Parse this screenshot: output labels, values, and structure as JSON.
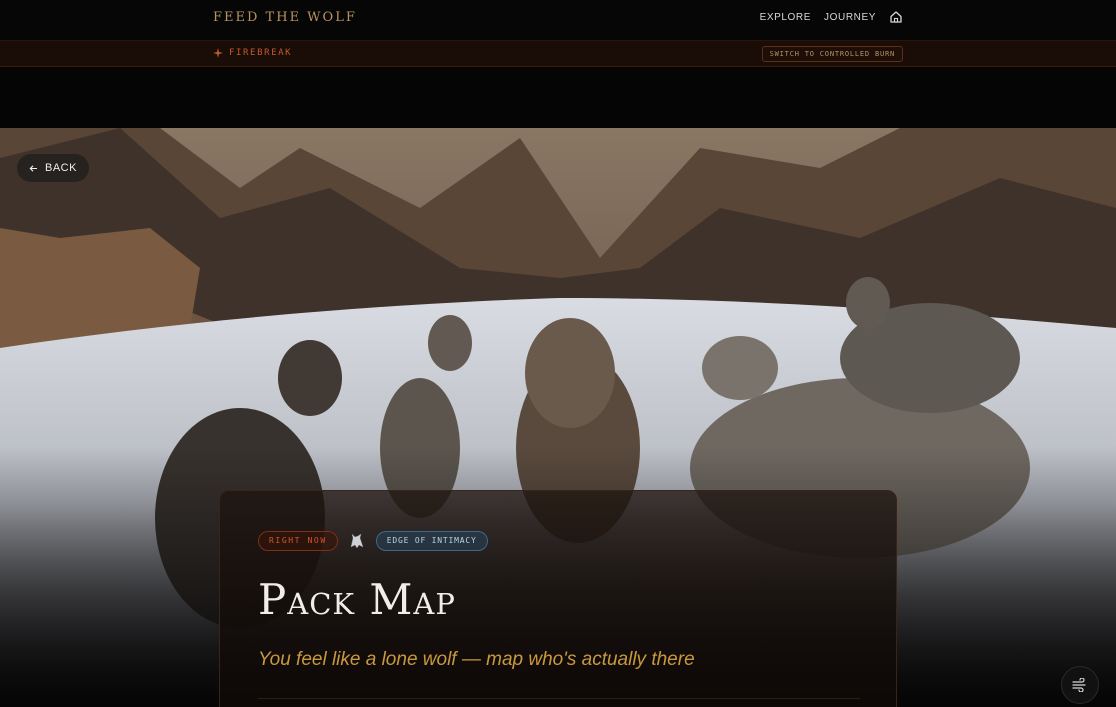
{
  "nav": {
    "brand": "FEED THE WOLF",
    "links": [
      "EXPLORE",
      "JOURNEY"
    ],
    "home_icon": "home-icon"
  },
  "firebar": {
    "label": "FIREBREAK",
    "icon": "spark-icon",
    "switch_label": "SWITCH TO CONTROLLED BURN"
  },
  "hero": {
    "back_label": "BACK",
    "back_icon": "arrow-left-icon"
  },
  "card": {
    "tag_now": "RIGHT NOW",
    "tag_icon": "wolf-icon",
    "tag_edge": "EDGE OF INTIMACY",
    "title": "Pack Map",
    "subtitle": "You feel like a lone wolf — map who's actually there"
  },
  "fab": {
    "icon": "wind-icon"
  },
  "colors": {
    "accent_gold": "#c9983e",
    "accent_fire": "#c15a2d",
    "accent_blue": "#3d6a85"
  }
}
